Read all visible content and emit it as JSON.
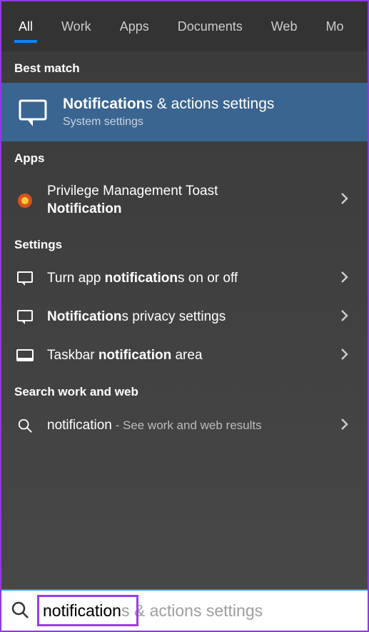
{
  "tabs": {
    "all": "All",
    "work": "Work",
    "apps": "Apps",
    "documents": "Documents",
    "web": "Web",
    "more": "Mo"
  },
  "sections": {
    "best_match": "Best match",
    "apps": "Apps",
    "settings": "Settings",
    "search_web": "Search work and web"
  },
  "best_match": {
    "title_hl": "Notification",
    "title_rest": "s & actions settings",
    "subtitle": "System settings"
  },
  "apps_results": [
    {
      "line1": "Privilege Management Toast",
      "line2_hl": "Notification"
    }
  ],
  "settings_results": [
    {
      "pre": "Turn app ",
      "hl": "notification",
      "post": "s on or off"
    },
    {
      "pre": "",
      "hl": "Notification",
      "post": "s privacy settings"
    },
    {
      "pre": "Taskbar ",
      "hl": "notification",
      "post": " area"
    }
  ],
  "web_result": {
    "term": "notification",
    "suffix": " - See work and web results"
  },
  "search": {
    "typed": "notification",
    "ghost_full": "notifications & actions settings"
  }
}
